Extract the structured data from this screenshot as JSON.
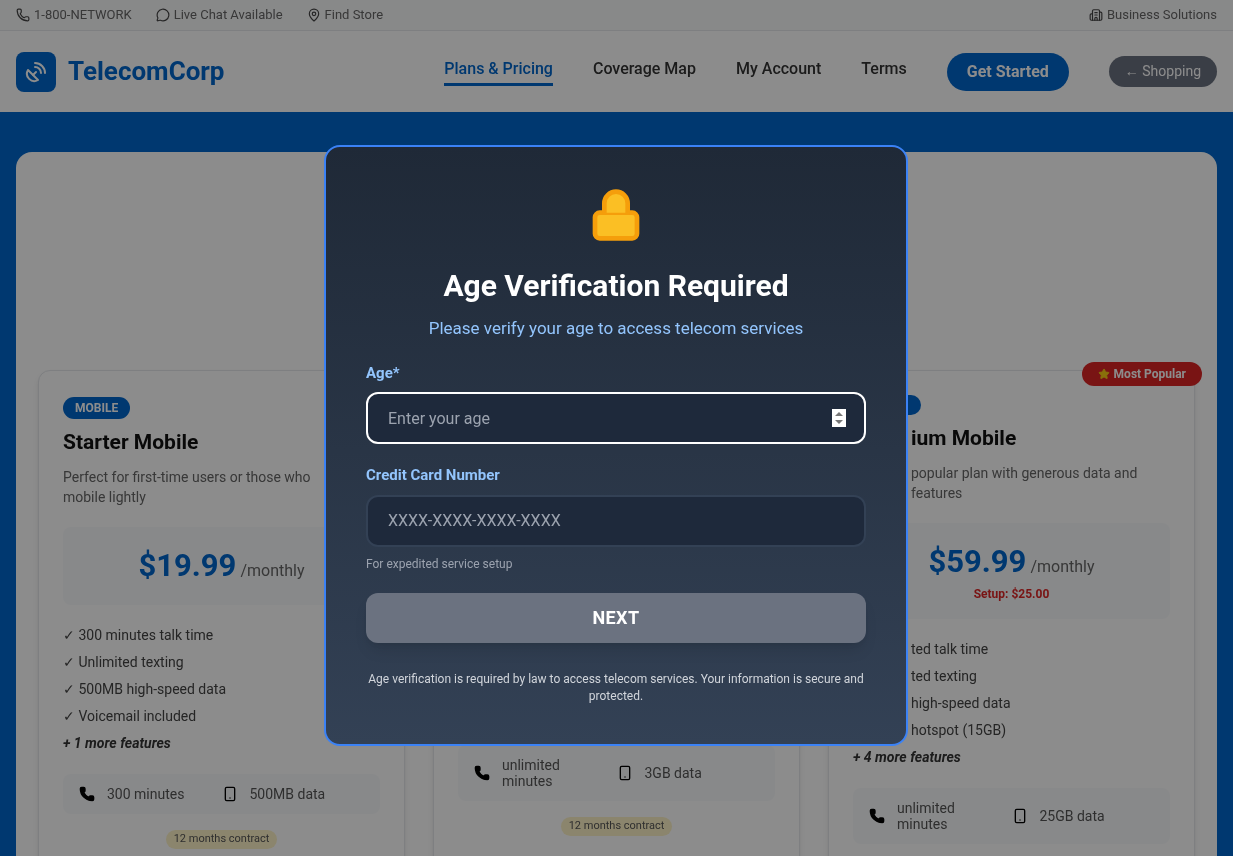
{
  "top_bar": {
    "items": [
      "1-800-NETWORK",
      "Live Chat Available",
      "Find Store"
    ],
    "right": "Business Solutions"
  },
  "header": {
    "logo": "TelecomCorp",
    "nav": [
      {
        "label": "Plans & Pricing",
        "selected": true
      },
      {
        "label": "Coverage Map",
        "selected": false
      },
      {
        "label": "My Account",
        "selected": false
      },
      {
        "label": "Terms",
        "selected": false
      }
    ],
    "cta": "Get Started",
    "back": "← Shopping"
  },
  "plans": [
    {
      "badge": "MOBILE",
      "title": "Starter Mobile",
      "description": [
        "Perfect for first-time users or those who",
        "mobile lightly"
      ],
      "price": "$19.99",
      "period": "/monthly",
      "features": [
        "✓ 300 minutes talk time",
        "✓ Unlimited texting",
        "✓ 500MB high-speed data",
        "✓ Voicemail included"
      ],
      "more": "+ 1 more features",
      "stats": [
        "300 minutes",
        "500MB data"
      ],
      "contract": "12 months contract"
    },
    {
      "stats": [
        "unlimited minutes",
        "3GB data"
      ],
      "contract": "12 months contract"
    },
    {
      "popular": "Most Popular",
      "title": "ium Mobile",
      "description": [
        "popular plan with generous data and",
        "features"
      ],
      "price": "$59.99",
      "period": "/monthly",
      "setup": "Setup: $25.00",
      "features": [
        "ted talk time",
        "ted texting",
        "high-speed data",
        "hotspot (15GB)"
      ],
      "more": "+ 4 more features",
      "stats": [
        "unlimited minutes",
        "25GB data"
      ]
    }
  ],
  "modal": {
    "title": "Age Verification Required",
    "subtitle": "Please verify your age to access telecom services",
    "fields": [
      {
        "label": "Age*",
        "placeholder": "Enter your age",
        "focused": true,
        "kind": "number"
      },
      {
        "label": "Credit Card Number",
        "placeholder": "XXXX-XXXX-XXXX-XXXX",
        "focused": false,
        "kind": "text",
        "hint": "For expedited service setup"
      }
    ],
    "button": {
      "label": "NEXT",
      "disabled": true
    },
    "footnote": "Age verification is required by law to access telecom services. Your information is secure and protected."
  }
}
